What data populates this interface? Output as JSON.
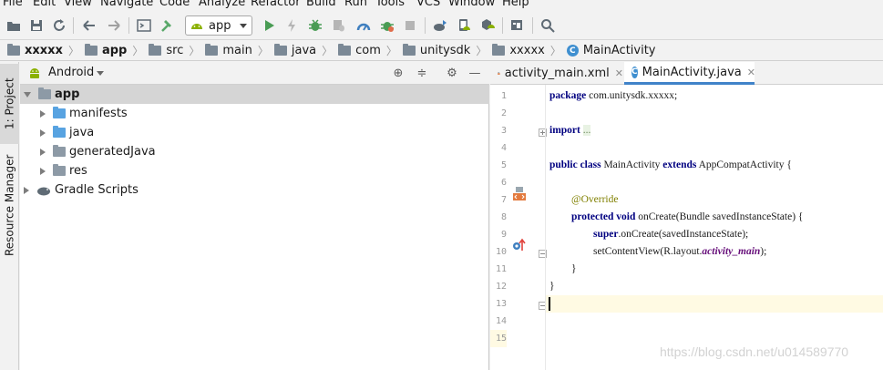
{
  "menu": [
    "File",
    "Edit",
    "View",
    "Navigate",
    "Code",
    "Analyze",
    "Refactor",
    "Build",
    "Run",
    "Tools",
    "VCS",
    "Window",
    "Help"
  ],
  "toolbar": {
    "run_config": "app",
    "icons": [
      "open-icon",
      "save-icon",
      "sync-icon",
      "back-icon",
      "forward-icon",
      "tool-window-icon",
      "make-hammer-icon",
      "run-icon",
      "apply-changes-icon",
      "debug-icon",
      "attach-debugger-icon",
      "profile-icon",
      "coverage-icon",
      "stop-icon",
      "sync-gradle-icon",
      "avd-manager-icon",
      "sdk-manager-icon",
      "project-structure-icon",
      "search-icon"
    ]
  },
  "breadcrumbs": [
    "xxxxx",
    "app",
    "src",
    "main",
    "java",
    "com",
    "unitysdk",
    "xxxxx",
    "MainActivity"
  ],
  "left_stripe": {
    "project_tab": "1: Project",
    "resource_tab": "Resource Manager"
  },
  "project": {
    "view_selector": "Android",
    "tree": [
      {
        "label": "app",
        "expanded": true,
        "level": 0
      },
      {
        "label": "manifests",
        "level": 1
      },
      {
        "label": "java",
        "level": 1
      },
      {
        "label": "generatedJava",
        "level": 1
      },
      {
        "label": "res",
        "level": 1
      },
      {
        "label": "Gradle Scripts",
        "level": 0
      }
    ]
  },
  "editor": {
    "tabs": [
      {
        "label": "activity_main.xml",
        "active": false
      },
      {
        "label": "MainActivity.java",
        "active": true
      }
    ],
    "line_numbers": [
      "1",
      "2",
      "3",
      "4",
      "5",
      "6",
      "7",
      "8",
      "9",
      "10",
      "11",
      "12",
      "13",
      "14",
      "15"
    ],
    "code": {
      "l1_kw": "package",
      "l1_rest": " com.unitysdk.xxxxx;",
      "l3_kw": "import",
      "l3_fold": "...",
      "l7_kw1": "public",
      "l7_kw2": "class",
      "l7_mid": " MainActivity ",
      "l7_kw3": "extends",
      "l7_rest": " AppCompatActivity {",
      "l9_ann": "@Override",
      "l10_kw1": "protected",
      "l10_kw2": "void",
      "l10_rest": " onCreate(Bundle savedInstanceState) {",
      "l11_kw": "super",
      "l11_rest": ".onCreate(savedInstanceState);",
      "l12_pre": "setContentView(R.layout.",
      "l12_fld": "activity_main",
      "l12_post": ");",
      "l13": "}",
      "l14": "}"
    }
  },
  "watermark": "https://blog.csdn.net/u014589770"
}
